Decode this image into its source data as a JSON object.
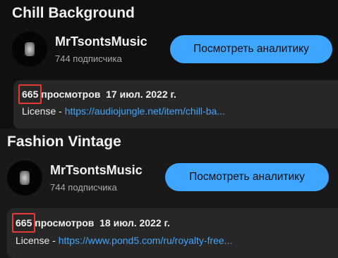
{
  "videos": [
    {
      "title": "Chill Background",
      "channel_name": "MrTsontsMusic",
      "subscribers": "744 подписчика",
      "analytics_button": "Посмотреть аналитику",
      "views_count": "665",
      "views_label": "просмотров",
      "date": "17 июл. 2022 г.",
      "license_label": "License - ",
      "license_link": "https://audiojungle.net/item/chill-ba..."
    },
    {
      "title": "Fashion Vintage",
      "channel_name": "MrTsontsMusic",
      "subscribers": "744 подписчика",
      "analytics_button": "Посмотреть аналитику",
      "views_count": "665",
      "views_label": "просмотров",
      "date": "18 июл. 2022 г.",
      "license_label": "License - ",
      "license_link": "https://www.pond5.com/ru/royalty-free..."
    }
  ],
  "colors": {
    "accent": "#3ea6ff",
    "highlight": "#e53935",
    "background": "#101010",
    "description_bg": "#272727"
  }
}
